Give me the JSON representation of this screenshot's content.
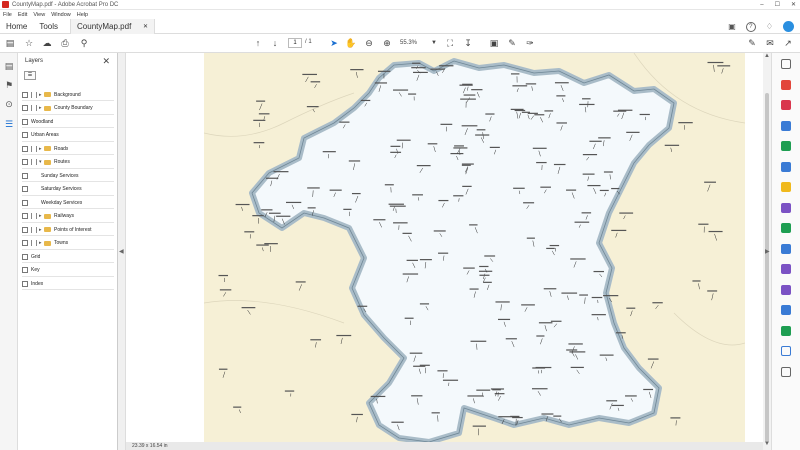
{
  "window": {
    "title": "CountyMap.pdf - Adobe Acrobat Pro DC",
    "controls": [
      "–",
      "☐",
      "✕"
    ]
  },
  "menu": [
    "File",
    "Edit",
    "View",
    "Window",
    "Help"
  ],
  "tabs": {
    "home": "Home",
    "tools": "Tools",
    "document": "CountyMap.pdf",
    "close": "✕"
  },
  "toolbar": {
    "page_current": "1",
    "page_total": "/ 1",
    "zoom": "55.3%"
  },
  "layers": {
    "title": "Layers",
    "close": "✕",
    "options": "☰",
    "items": [
      {
        "label": "Background",
        "type": "folder"
      },
      {
        "label": "County Boundary",
        "type": "folder"
      },
      {
        "label": "Woodland",
        "type": "layer"
      },
      {
        "label": "Urban Areas",
        "type": "layer"
      },
      {
        "label": "Roads",
        "type": "folder"
      },
      {
        "label": "Routes",
        "type": "folder-open"
      },
      {
        "label": "Sunday Services",
        "type": "child"
      },
      {
        "label": "Saturday Services",
        "type": "child"
      },
      {
        "label": "Weekday Services",
        "type": "child"
      },
      {
        "label": "Railways",
        "type": "folder"
      },
      {
        "label": "Points of Interest",
        "type": "folder"
      },
      {
        "label": "Towns",
        "type": "folder"
      },
      {
        "label": "Grid",
        "type": "layer"
      },
      {
        "label": "Key",
        "type": "layer"
      },
      {
        "label": "Index",
        "type": "layer"
      }
    ]
  },
  "status": {
    "dimensions": "23.39 x 16.54 in"
  },
  "colors": {
    "accent": "#2a8fe0",
    "map_bg": "#f6f0d6",
    "county_fill": "#f4f9fc",
    "county_border": "#a9bcc8",
    "folder": "#e8b84a"
  }
}
